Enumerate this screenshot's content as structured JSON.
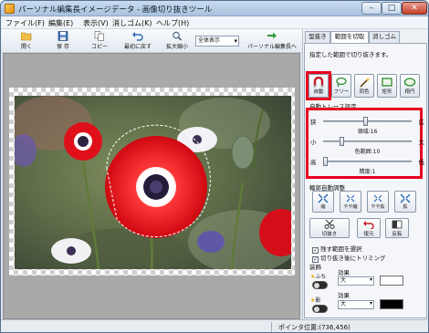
{
  "window": {
    "title": "パーソナル編集長イメージデータ - 画像切り抜きツール",
    "controls": {
      "minimize": "–",
      "maximize": "□",
      "close": "✕"
    }
  },
  "menu": [
    "ファイル(F)",
    "編集(E)",
    "表示(V)",
    "消しゴム(K)",
    "ヘルプ(H)"
  ],
  "toolbar": {
    "open": "開く",
    "save": "保 存",
    "copy": "コピー",
    "revert": "最初に戻す",
    "zoom": "拡大縮小",
    "zoom_value": "全体表示",
    "to_app": "パーソナル編集長へ"
  },
  "panel": {
    "tabs": [
      "型抜き",
      "範囲を切取",
      "消しゴム"
    ],
    "active_tab": 1,
    "instruction": "指定した範囲で切り抜きます。",
    "tools": [
      "自動",
      "フリー",
      "同色",
      "矩形",
      "楕円"
    ],
    "auto_trace": {
      "heading": "自動トレース設定",
      "sliders": [
        {
          "left": "狭",
          "right": "広",
          "label": "領域:16",
          "value": 16
        },
        {
          "left": "小",
          "right": "大",
          "label": "色範囲:10",
          "value": 10
        },
        {
          "left": "高",
          "right": "低",
          "label": "精度:1",
          "value": 1
        }
      ]
    },
    "adjust": {
      "heading": "輪郭自動調整",
      "buttons": [
        "縮",
        "やや縮",
        "やや拡",
        "拡"
      ]
    },
    "actions": {
      "cut": "切抜き",
      "restore": "復元",
      "invert": "反転"
    },
    "checkboxes": [
      {
        "label": "残す範囲を選択",
        "checked": true
      },
      {
        "label": "切り抜き後にトリミング",
        "checked": true
      }
    ],
    "decoration": {
      "heading": "装飾",
      "rows": [
        {
          "label": "ふち",
          "effect_label": "効果",
          "size": "大",
          "color": "#ffffff"
        },
        {
          "label": "影",
          "effect_label": "効果",
          "size": "大",
          "color": "#000000"
        }
      ]
    }
  },
  "status": {
    "pointer": "ポインタ位置:(736,456)"
  },
  "colors": {
    "highlight": "#e8001f",
    "canvas_bg": "#a9a9a9",
    "titlebar": "#b8cde4"
  }
}
